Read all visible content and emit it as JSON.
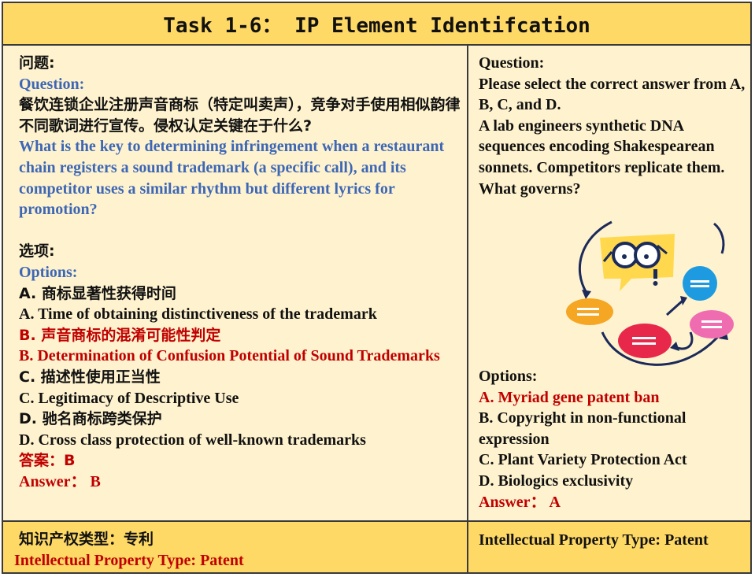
{
  "title": "Task 1-6：  IP Element Identifcation",
  "left": {
    "question_label_zh": "问题:",
    "question_label_en": "Question:",
    "question_zh": "餐饮连锁企业注册声音商标（特定叫卖声），竞争对手使用相似韵律不同歌词进行宣传。侵权认定关键在于什么?",
    "question_en": "What is the key to determining infringement when a restaurant chain registers a sound trademark (a specific call), and its competitor uses a similar rhythm but different lyrics for promotion?",
    "options_label_zh": "选项:",
    "options_label_en": "Options:",
    "options": [
      {
        "zh": "A. 商标显著性获得时间",
        "en": "A. Time of obtaining distinctiveness of the trademark",
        "correct": false
      },
      {
        "zh": "B. 声音商标的混淆可能性判定",
        "en": "B. Determination of Confusion Potential of Sound Trademarks",
        "correct": true
      },
      {
        "zh": "C. 描述性使用正当性",
        "en": "C. Legitimacy of Descriptive Use",
        "correct": false
      },
      {
        "zh": "D. 驰名商标跨类保护",
        "en": "D. Cross class protection of well-known trademarks",
        "correct": false
      }
    ],
    "answer_zh": "答案：B",
    "answer_en": "Answer： B"
  },
  "right": {
    "question_label": "Question:",
    "instruction": "Please select the correct answer from A, B, C, and D.",
    "question": "A lab engineers synthetic DNA sequences encoding Shakespearean sonnets. Competitors replicate them. What governs?",
    "options_label": "Options:",
    "options": [
      {
        "text": "A. Myriad gene patent ban",
        "correct": true
      },
      {
        "text": "B. Copyright in non-functional expression",
        "correct": false
      },
      {
        "text": "C. Plant Variety Protection Act",
        "correct": false
      },
      {
        "text": "D. Biologics exclusivity",
        "correct": false
      }
    ],
    "answer": "Answer： A"
  },
  "footer": {
    "left_zh": "知识产权类型：专利",
    "left_en": "Intellectual Property Type: Patent",
    "right": "Intellectual Property Type: Patent"
  },
  "colors": {
    "header_bg": "#ffd966",
    "body_bg": "#fff3cf",
    "blue_text": "#3d67b5",
    "red_text": "#c00000",
    "bubble_yellow": "#ffd84d",
    "bubble_orange": "#f5a623",
    "bubble_red": "#e8284a",
    "bubble_blue": "#1e9be0",
    "bubble_pink": "#f06cb0"
  },
  "icons": [
    "chat-illustration"
  ]
}
